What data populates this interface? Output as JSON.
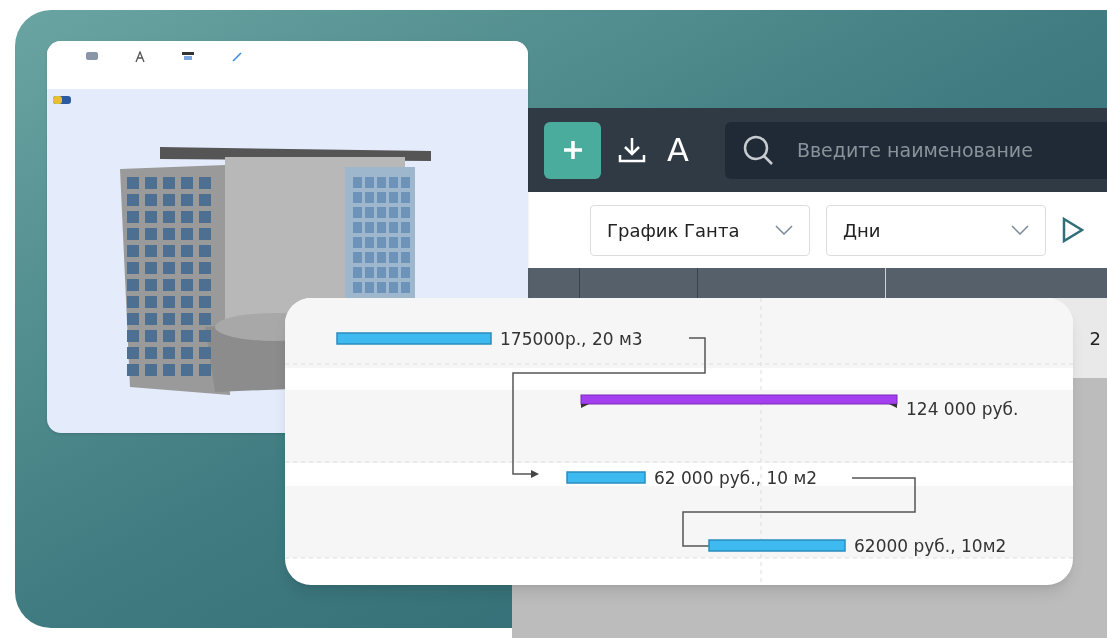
{
  "app": {
    "font_button": "A",
    "search": {
      "placeholder": "Введите наименование"
    },
    "view_select": "График Ганта",
    "scale_select": "Дни",
    "column_header": "2"
  },
  "gantt": {
    "tasks": [
      {
        "label": "175000р., 20 м3",
        "kind": "task"
      },
      {
        "label": "124 000 руб.",
        "kind": "summary"
      },
      {
        "label": "62 000 руб., 10 м2",
        "kind": "task"
      },
      {
        "label": "62000 руб., 10м2",
        "kind": "task"
      }
    ]
  }
}
